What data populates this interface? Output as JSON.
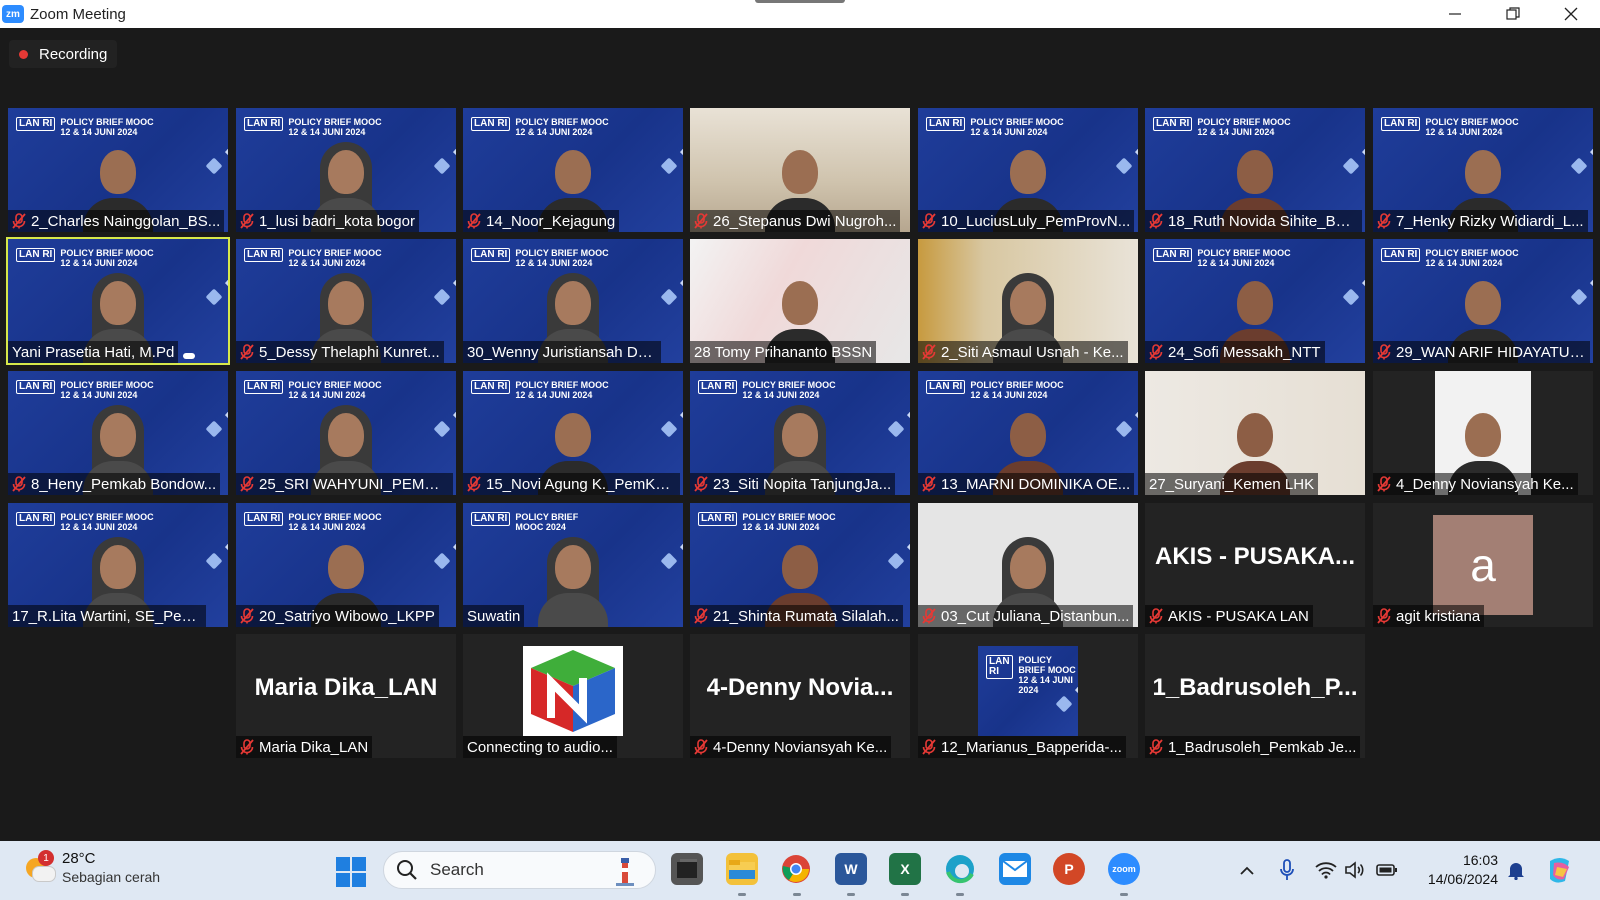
{
  "window": {
    "title": "Zoom Meeting",
    "app_icon": "zm",
    "controls": [
      "minimize-icon",
      "restore-icon",
      "close-icon"
    ]
  },
  "recording": {
    "label": "Recording",
    "color": "#e53935"
  },
  "banner": {
    "logo": "LAN RI",
    "title": "POLICY BRIEF MOOC",
    "date": "12 & 14 JUNI 2024",
    "title_alt_1": "POLICY BRIEF",
    "title_alt_2": "MOOC 2024"
  },
  "participants": [
    {
      "name": "2_Charles Nainggolan_BS...",
      "muted": true
    },
    {
      "name": "1_lusi badri_kota bogor",
      "muted": true
    },
    {
      "name": "14_Noor_Kejagung",
      "muted": true
    },
    {
      "name": "26_Stepanus Dwi Nugroh...",
      "muted": true
    },
    {
      "name": "10_LuciusLuly_PemProvN...",
      "muted": true
    },
    {
      "name": "18_Ruth Novida Sihite_BS...",
      "muted": true
    },
    {
      "name": "7_Henky Rizky Widiardi_L...",
      "muted": true
    },
    {
      "name": "Yani Prasetia Hati, M.Pd",
      "muted": false,
      "active_speaker": true
    },
    {
      "name": "5_Dessy Thelaphi Kunret...",
      "muted": true
    },
    {
      "name": "30_Wenny Juristiansah D_Dis...",
      "muted": false
    },
    {
      "name": "28 Tomy Prihananto BSSN",
      "muted": false
    },
    {
      "name": "2_Siti Asmaul Usnah - Ke...",
      "muted": true
    },
    {
      "name": "24_Sofi Messakh_NTT",
      "muted": true
    },
    {
      "name": "29_WAN ARIF HIDAYATUL...",
      "muted": true
    },
    {
      "name": "8_Heny_Pemkab Bondow...",
      "muted": true
    },
    {
      "name": "25_SRI WAHYUNI_PEMPR...",
      "muted": true
    },
    {
      "name": "15_Novi Agung K._PemKa...",
      "muted": true
    },
    {
      "name": "23_Siti Nopita TanjungJa...",
      "muted": true
    },
    {
      "name": "13_MARNI DOMINIKA OE...",
      "muted": true
    },
    {
      "name": "27_Suryani_Kemen LHK",
      "muted": false
    },
    {
      "name": "4_Denny Noviansyah Ke...",
      "muted": true
    },
    {
      "name": "17_R.Lita Wartini, SE_Pemkab...",
      "muted": false
    },
    {
      "name": "20_Satriyo Wibowo_LKPP",
      "muted": true
    },
    {
      "name": "Suwatin",
      "muted": false
    },
    {
      "name": "21_Shinta Rumata Silalah...",
      "muted": true
    },
    {
      "name": "03_Cut Juliana_Distanbun...",
      "muted": true
    },
    {
      "name": "AKIS - PUSAKA LAN",
      "muted": true,
      "display_name": "AKIS  -  PUSAKA..."
    },
    {
      "name": "agit kristiana",
      "muted": true,
      "avatar_letter": "a"
    },
    {
      "name": "Maria Dika_LAN",
      "muted": true,
      "display_name": "Maria Dika_LAN"
    },
    {
      "name": "Connecting to audio",
      "muted": false,
      "suffix": "..."
    },
    {
      "name": "4-Denny Noviansyah Ke...",
      "muted": true,
      "display_name": "4-Denny  Novia..."
    },
    {
      "name": "12_Marianus_Bapperida-...",
      "muted": true
    },
    {
      "name": "1_Badrusoleh_Pemkab Je...",
      "muted": true,
      "display_name": "1_Badrusoleh_P..."
    }
  ],
  "taskbar": {
    "weather": {
      "temp": "28°C",
      "desc": "Sebagian cerah",
      "badge": "1"
    },
    "search_placeholder": "Search",
    "apps": [
      "start-icon",
      "file-explorer-icon",
      "chrome-icon",
      "word-icon",
      "excel-icon",
      "edge-icon",
      "mail-icon",
      "powerpoint-icon",
      "zoom-icon"
    ],
    "zoom_label": "zoom",
    "clock": {
      "time": "16:03",
      "date": "14/06/2024"
    }
  },
  "colors": {
    "active_border": "#d7e84a",
    "banner_blue": "#1f3d9a",
    "taskbar": "#dfe8f3"
  }
}
